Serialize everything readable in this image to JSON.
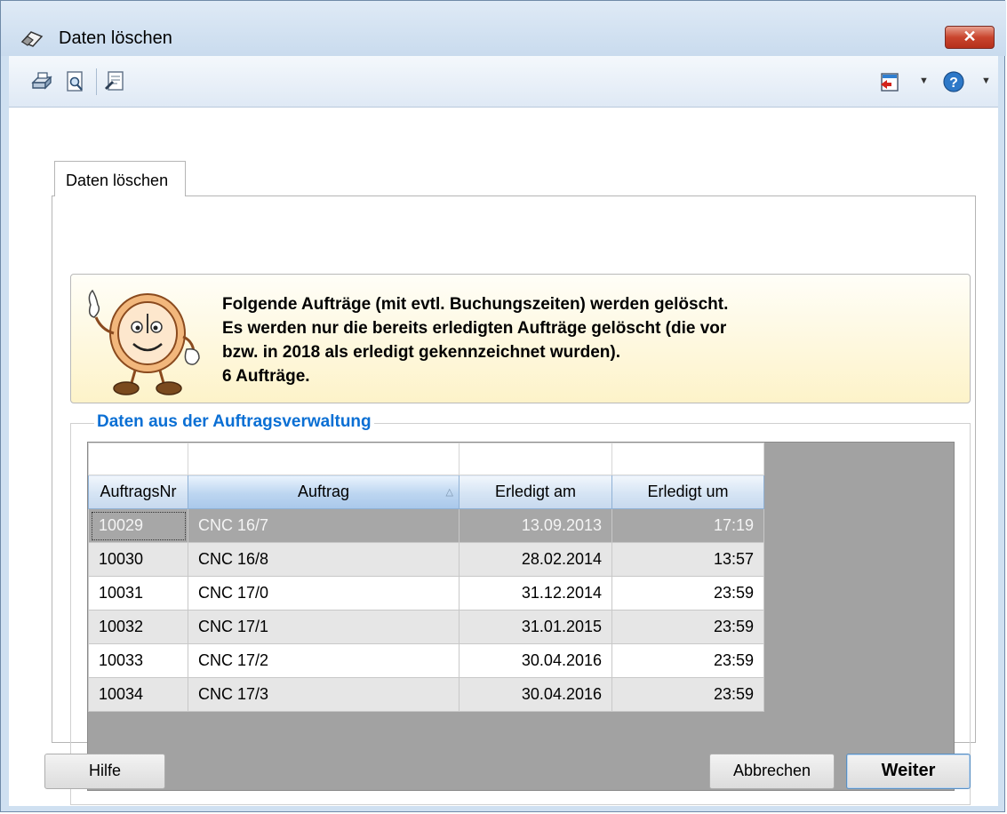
{
  "window": {
    "title": "Daten löschen",
    "close_symbol": "✕"
  },
  "toolbar": {
    "icons": [
      "print-icon",
      "print-preview-icon",
      "export-document-icon",
      "exit-icon",
      "help-icon"
    ]
  },
  "tab": {
    "label": "Daten löschen"
  },
  "info": {
    "lines": [
      "Folgende Aufträge (mit evtl. Buchungszeiten) werden gelöscht.",
      "Es werden nur die bereits erledigten Aufträge gelöscht (die vor",
      "bzw. in 2018 als erledigt gekennzeichnet wurden).",
      "6 Aufträge."
    ]
  },
  "group": {
    "legend": "Daten aus der Auftragsverwaltung"
  },
  "grid": {
    "columns": [
      "AuftragsNr",
      "Auftrag",
      "Erledigt am",
      "Erledigt um"
    ],
    "rows": [
      [
        "10029",
        "CNC 16/7",
        "13.09.2013",
        "17:19"
      ],
      [
        "10030",
        "CNC 16/8",
        "28.02.2014",
        "13:57"
      ],
      [
        "10031",
        "CNC 17/0",
        "31.12.2014",
        "23:59"
      ],
      [
        "10032",
        "CNC 17/1",
        "31.01.2015",
        "23:59"
      ],
      [
        "10033",
        "CNC 17/2",
        "30.04.2016",
        "23:59"
      ],
      [
        "10034",
        "CNC 17/3",
        "30.04.2016",
        "23:59"
      ]
    ],
    "selected_row": 0,
    "sort_column": "Auftrag",
    "sort_direction": "ascending"
  },
  "buttons": {
    "help": "Hilfe",
    "cancel": "Abbrechen",
    "next": "Weiter"
  }
}
